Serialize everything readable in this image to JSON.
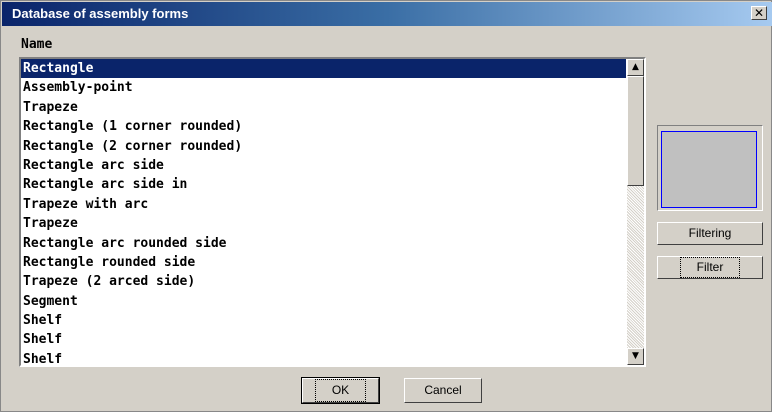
{
  "window": {
    "title": "Database of assembly forms",
    "close_glyph": "✕"
  },
  "list": {
    "column_label": "Name",
    "items": [
      "Rectangle",
      "Assembly-point",
      "Trapeze",
      "Rectangle (1 corner rounded)",
      "Rectangle (2 corner rounded)",
      "Rectangle arc side",
      "Rectangle arc side in",
      "Trapeze with arc",
      "Trapeze",
      "Rectangle arc rounded side",
      "Rectangle rounded side",
      "Trapeze (2 arced side)",
      "Segment",
      "Shelf",
      "Shelf",
      "Shelf"
    ],
    "selected_index": 0,
    "scroll_up_glyph": "▲",
    "scroll_down_glyph": "▼"
  },
  "side": {
    "filtering_label": "Filtering",
    "filter_label": "Filter"
  },
  "footer": {
    "ok_label": "OK",
    "cancel_label": "Cancel"
  },
  "colors": {
    "selection": "#0a246a",
    "preview_border": "#0000ff",
    "preview_fill": "#c0c0c0"
  }
}
